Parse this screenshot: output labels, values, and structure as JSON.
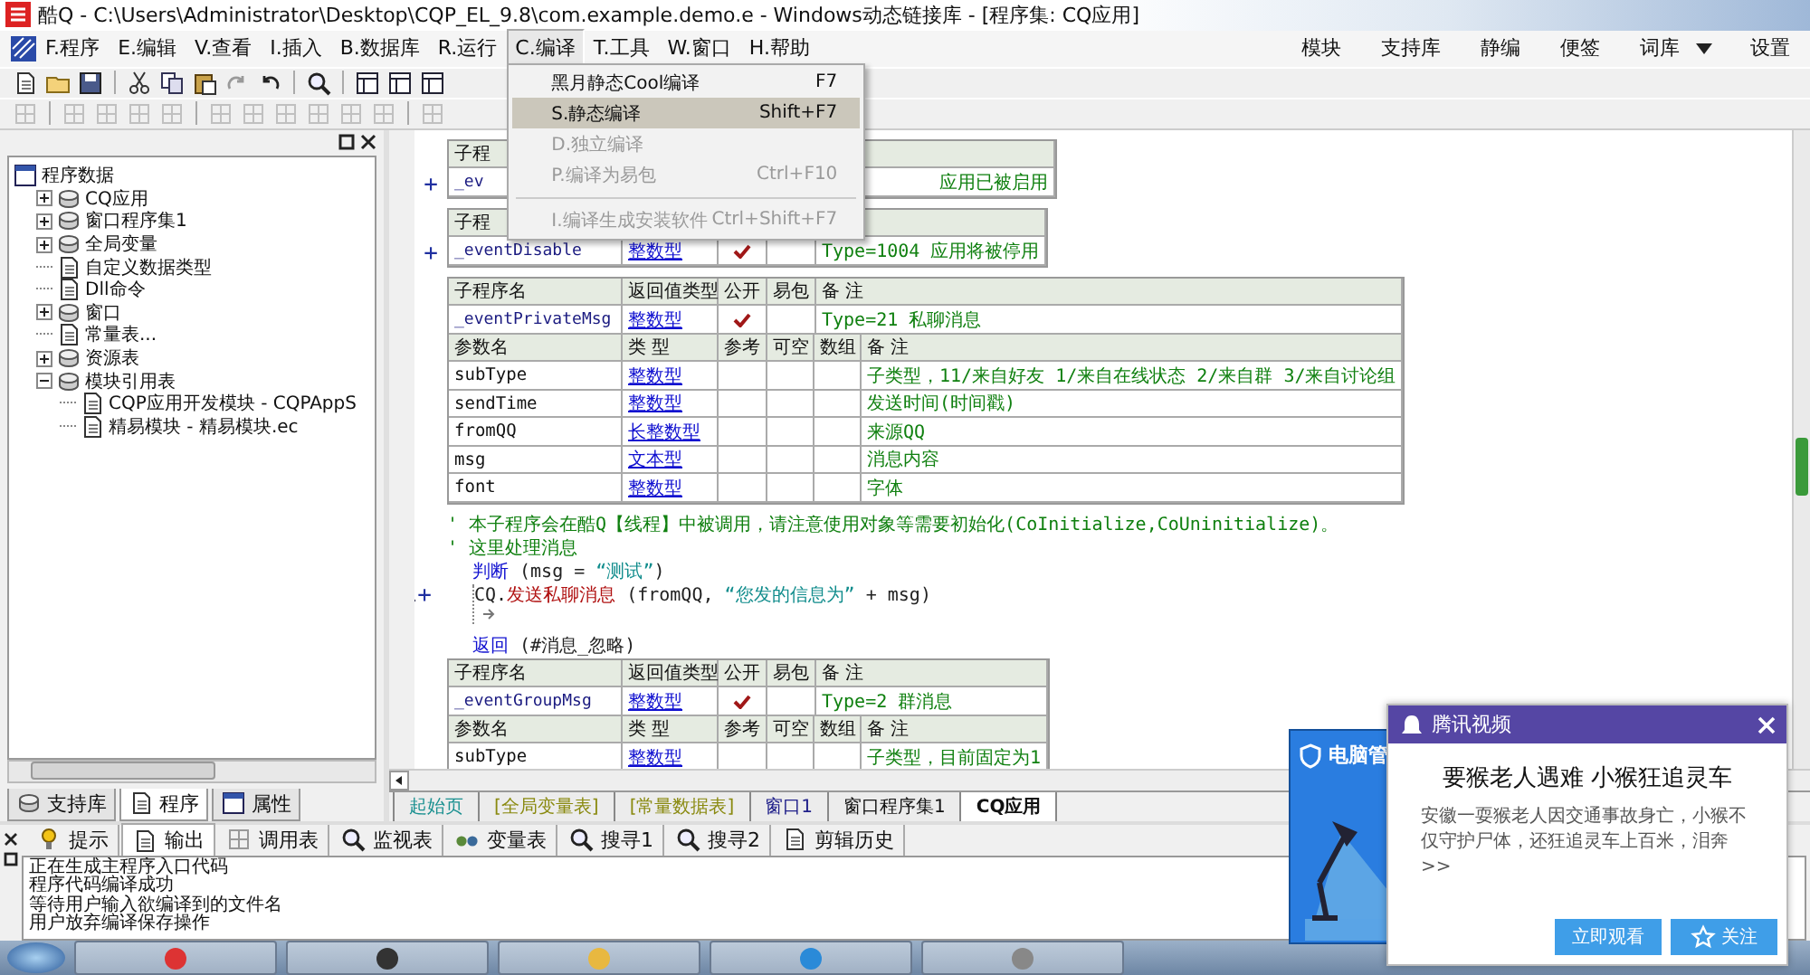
{
  "window": {
    "title": "酷Q - C:\\Users\\Administrator\\Desktop\\CQP_EL_9.8\\com.example.demo.e - Windows动态链接库 - [程序集: CQ应用]"
  },
  "menu": [
    {
      "label": "F.程序",
      "selected": false
    },
    {
      "label": "E.编辑",
      "selected": false
    },
    {
      "label": "V.查看",
      "selected": false
    },
    {
      "label": "I.插入",
      "selected": false
    },
    {
      "label": "B.数据库",
      "selected": false
    },
    {
      "label": "R.运行",
      "selected": false
    },
    {
      "label": "C.编译",
      "selected": true
    },
    {
      "label": "T.工具",
      "selected": false
    },
    {
      "label": "W.窗口",
      "selected": false
    },
    {
      "label": "H.帮助",
      "selected": false
    }
  ],
  "quick_menu": [
    {
      "label": "模块",
      "dropdown": false
    },
    {
      "label": "支持库",
      "dropdown": false
    },
    {
      "label": "静编",
      "dropdown": false
    },
    {
      "label": "便签",
      "dropdown": false
    },
    {
      "label": "词库",
      "dropdown": true
    },
    {
      "label": "设置",
      "dropdown": false
    }
  ],
  "compile_menu": {
    "items": [
      {
        "label": "黑月静态Cool编译",
        "shortcut": "F7",
        "disabled": false,
        "selected": false,
        "separator_before": false
      },
      {
        "label": "S.静态编译",
        "shortcut": "Shift+F7",
        "disabled": false,
        "selected": true,
        "separator_before": false
      },
      {
        "label": "D.独立编译",
        "disabled": true,
        "selected": false,
        "separator_before": false
      },
      {
        "label": "P.编译为易包",
        "shortcut": "Ctrl+F10",
        "disabled": true,
        "selected": false,
        "separator_before": false
      },
      {
        "label": "I.编译生成安装软件",
        "shortcut": "Ctrl+Shift+F7",
        "disabled": true,
        "selected": false,
        "separator_before": true
      }
    ]
  },
  "project_tree": {
    "label": "程序数据",
    "children": [
      {
        "label": "CQ应用",
        "expanded": false
      },
      {
        "label": "窗口程序集1",
        "expanded": false
      },
      {
        "label": "全局变量",
        "expanded": false
      },
      {
        "label": "自定义数据类型"
      },
      {
        "label": "Dll命令"
      },
      {
        "label": "窗口",
        "expanded": false
      },
      {
        "label": "常量表..."
      },
      {
        "label": "资源表",
        "expanded": false
      },
      {
        "label": "模块引用表",
        "expanded": true,
        "children": [
          {
            "label": "CQP应用开发模块 - CQPAppS"
          },
          {
            "label": "精易模块 - 精易模块.ec"
          }
        ]
      }
    ]
  },
  "left_tabs": [
    {
      "label": "支持库",
      "selected": false
    },
    {
      "label": "程序",
      "selected": true
    },
    {
      "label": "属性",
      "selected": false
    }
  ],
  "editor": {
    "blocks": [
      {
        "kind": "procedure",
        "gutter": "+",
        "header": [
          "子程"
        ],
        "name": "_ev",
        "note": "应用已被启用"
      },
      {
        "kind": "procedure",
        "gutter": "+",
        "header": [
          "子程"
        ],
        "name": "_eventDisable",
        "type": "整数型",
        "public": true,
        "note": "Type=1004 应用将被停用"
      },
      {
        "kind": "procedure",
        "header": [
          "子程序名",
          "返回值类型",
          "公开",
          "易包",
          "备 注"
        ],
        "name": "_eventPrivateMsg",
        "type": "整数型",
        "public": true,
        "note": "Type=21 私聊消息",
        "param_header": [
          "参数名",
          "类 型",
          "参考",
          "可空",
          "数组",
          "备 注"
        ],
        "params": [
          {
            "name": "subType",
            "type": "整数型",
            "note": "子类型，11/来自好友 1/来自在线状态 2/来自群 3/来自讨论组"
          },
          {
            "name": "sendTime",
            "type": "整数型",
            "note": "发送时间(时间戳)"
          },
          {
            "name": "fromQQ",
            "type": "长整数型",
            "note": "来源QQ"
          },
          {
            "name": "msg",
            "type": "文本型",
            "note": "消息内容"
          },
          {
            "name": "font",
            "type": "整数型",
            "note": "字体"
          }
        ]
      },
      {
        "kind": "comment",
        "text": "' 本子程序会在酷Q【线程】中被调用，请注意使用对象等需要初始化(CoInitialize,CoUninitialize)。"
      },
      {
        "kind": "comment",
        "text": "' 这里处理消息"
      },
      {
        "kind": "code",
        "segments": [
          {
            "text": "判断",
            "kind": "keyword"
          },
          {
            "text": " (msg = ",
            "kind": "plain"
          },
          {
            "text": "“测试”",
            "kind": "string"
          },
          {
            "text": ")",
            "kind": "plain"
          }
        ],
        "children": [
          {
            "kind": "code",
            "gutter": "+",
            "segments": [
              {
                "text": "CQ.",
                "kind": "plain"
              },
              {
                "text": "发送私聊消息",
                "kind": "call"
              },
              {
                "text": " (fromQQ, ",
                "kind": "plain"
              },
              {
                "text": "“您发的信息为”",
                "kind": "string"
              },
              {
                "text": " + msg)",
                "kind": "plain"
              }
            ]
          }
        ]
      },
      {
        "kind": "code",
        "segments": [
          {
            "text": "返回",
            "kind": "keyword"
          },
          {
            "text": " (#消息_忽略)",
            "kind": "plain"
          }
        ]
      },
      {
        "kind": "procedure",
        "header": [
          "子程序名",
          "返回值类型",
          "公开",
          "易包",
          "备 注"
        ],
        "name": "_eventGroupMsg",
        "type": "整数型",
        "public": true,
        "note": "Type=2 群消息",
        "param_header": [
          "参数名",
          "类 型",
          "参考",
          "可空",
          "数组",
          "备 注"
        ],
        "params": [
          {
            "name": "subType",
            "type": "整数型",
            "note": "子类型，目前固定为1"
          }
        ]
      }
    ]
  },
  "editor_tabs": [
    {
      "label": "起始页",
      "color": "#1a9090",
      "selected": false
    },
    {
      "label": "[全局变量表]",
      "color": "#8a8a10",
      "selected": false
    },
    {
      "label": "[常量数据表]",
      "color": "#8a8a10",
      "selected": false
    },
    {
      "label": "窗口1",
      "color": "#20208a",
      "selected": false
    },
    {
      "label": "窗口程序集1",
      "color": "#111111",
      "selected": false
    },
    {
      "label": "CQ应用",
      "color": "#111111",
      "selected": true
    }
  ],
  "output_tabs": [
    {
      "label": "提示",
      "selected": false
    },
    {
      "label": "输出",
      "selected": true
    },
    {
      "label": "调用表",
      "selected": false
    },
    {
      "label": "监视表",
      "selected": false
    },
    {
      "label": "变量表",
      "selected": false
    },
    {
      "label": "搜寻1",
      "selected": false
    },
    {
      "label": "搜寻2",
      "selected": false
    },
    {
      "label": "剪辑历史",
      "selected": false
    }
  ],
  "output_lines": [
    "正在生成主程序入口代码",
    "程序代码编译成功",
    "等待用户输入欲编译到的文件名",
    "用户放弃编译保存操作"
  ],
  "security_popup": {
    "title": "电脑管"
  },
  "news_popup": {
    "app": "腾讯视频",
    "headline": "要猴老人遇难 小猴狂追灵车",
    "summary": "安徽一耍猴老人因交通事故身亡，小猴不仅守护尸体，还狂追灵车上百米，泪奔>>",
    "buttons": [
      {
        "label": "立即观看",
        "kind": "watch"
      },
      {
        "label": "关注",
        "kind": "follow"
      }
    ]
  }
}
